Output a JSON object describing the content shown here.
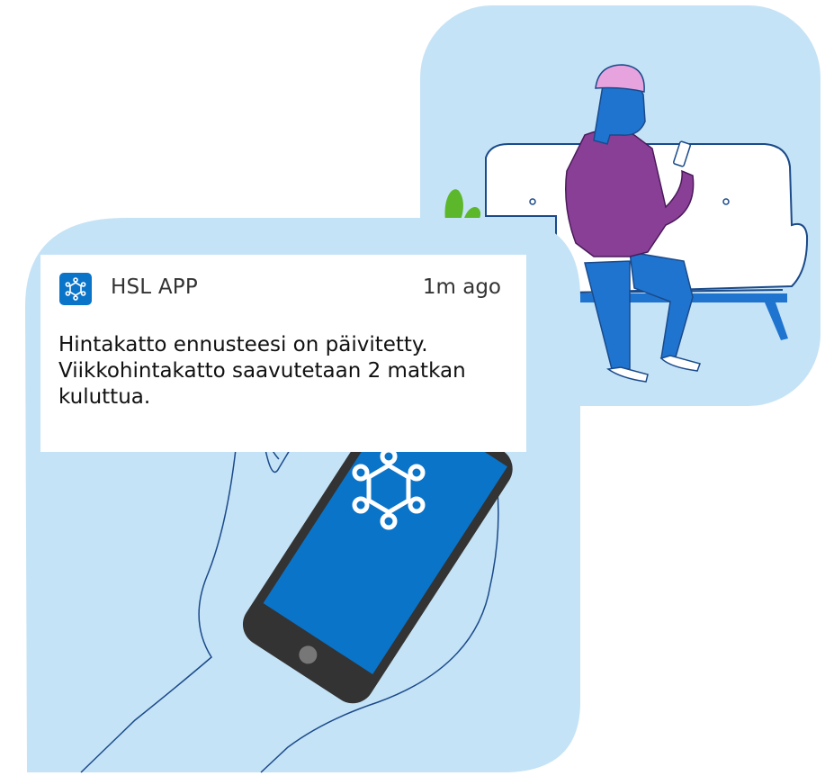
{
  "notification": {
    "app_icon": "hsl-logo-icon",
    "app_name": "HSL APP",
    "time": "1m ago",
    "message": "Hintakatto ennusteesi on päivitetty. Viikkohintakatto saavutetaan 2 matkan kuluttua."
  },
  "colors": {
    "panel_bg": "#c5e3f6",
    "hsl_blue": "#0a74c9",
    "hoodie": "#8a3f97",
    "beanie": "#e7a3de",
    "pants": "#1f74d0"
  }
}
